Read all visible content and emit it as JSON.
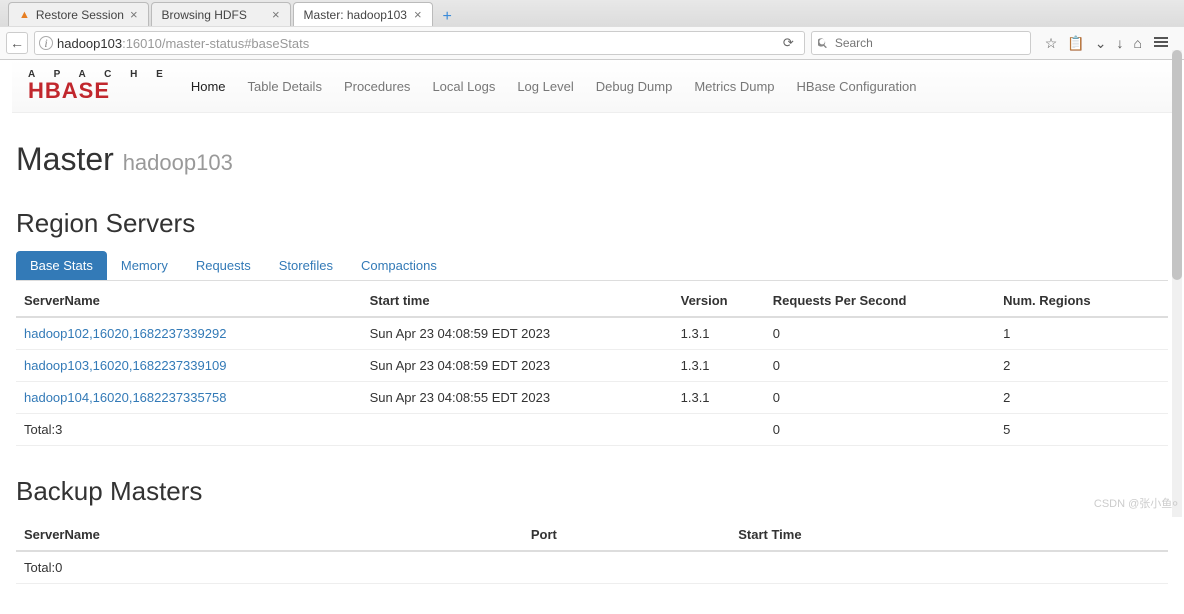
{
  "browser": {
    "tabs": [
      {
        "title": "Restore Session",
        "warn": true,
        "active": false
      },
      {
        "title": "Browsing HDFS",
        "warn": false,
        "active": false
      },
      {
        "title": "Master: hadoop103",
        "warn": false,
        "active": true
      }
    ],
    "url_host": "hadoop103",
    "url_rest": ":16010/master-status#baseStats",
    "search_placeholder": "Search"
  },
  "navbar": {
    "logo_top": "A P A C H E",
    "logo_main": "HBASE",
    "links": [
      {
        "label": "Home",
        "active": true
      },
      {
        "label": "Table Details",
        "active": false
      },
      {
        "label": "Procedures",
        "active": false
      },
      {
        "label": "Local Logs",
        "active": false
      },
      {
        "label": "Log Level",
        "active": false
      },
      {
        "label": "Debug Dump",
        "active": false
      },
      {
        "label": "Metrics Dump",
        "active": false
      },
      {
        "label": "HBase Configuration",
        "active": false
      }
    ]
  },
  "header": {
    "title": "Master",
    "subtitle": "hadoop103"
  },
  "region_servers": {
    "heading": "Region Servers",
    "tabs": [
      {
        "label": "Base Stats",
        "active": true
      },
      {
        "label": "Memory",
        "active": false
      },
      {
        "label": "Requests",
        "active": false
      },
      {
        "label": "Storefiles",
        "active": false
      },
      {
        "label": "Compactions",
        "active": false
      }
    ],
    "columns": [
      "ServerName",
      "Start time",
      "Version",
      "Requests Per Second",
      "Num. Regions"
    ],
    "rows": [
      {
        "server": "hadoop102,16020,1682237339292",
        "start": "Sun Apr 23 04:08:59 EDT 2023",
        "version": "1.3.1",
        "rps": "0",
        "regions": "1"
      },
      {
        "server": "hadoop103,16020,1682237339109",
        "start": "Sun Apr 23 04:08:59 EDT 2023",
        "version": "1.3.1",
        "rps": "0",
        "regions": "2"
      },
      {
        "server": "hadoop104,16020,1682237335758",
        "start": "Sun Apr 23 04:08:55 EDT 2023",
        "version": "1.3.1",
        "rps": "0",
        "regions": "2"
      }
    ],
    "total": {
      "label": "Total:3",
      "rps": "0",
      "regions": "5"
    }
  },
  "backup_masters": {
    "heading": "Backup Masters",
    "columns": [
      "ServerName",
      "Port",
      "Start Time"
    ],
    "total": "Total:0"
  },
  "watermark": "CSDN @张小鱼०"
}
